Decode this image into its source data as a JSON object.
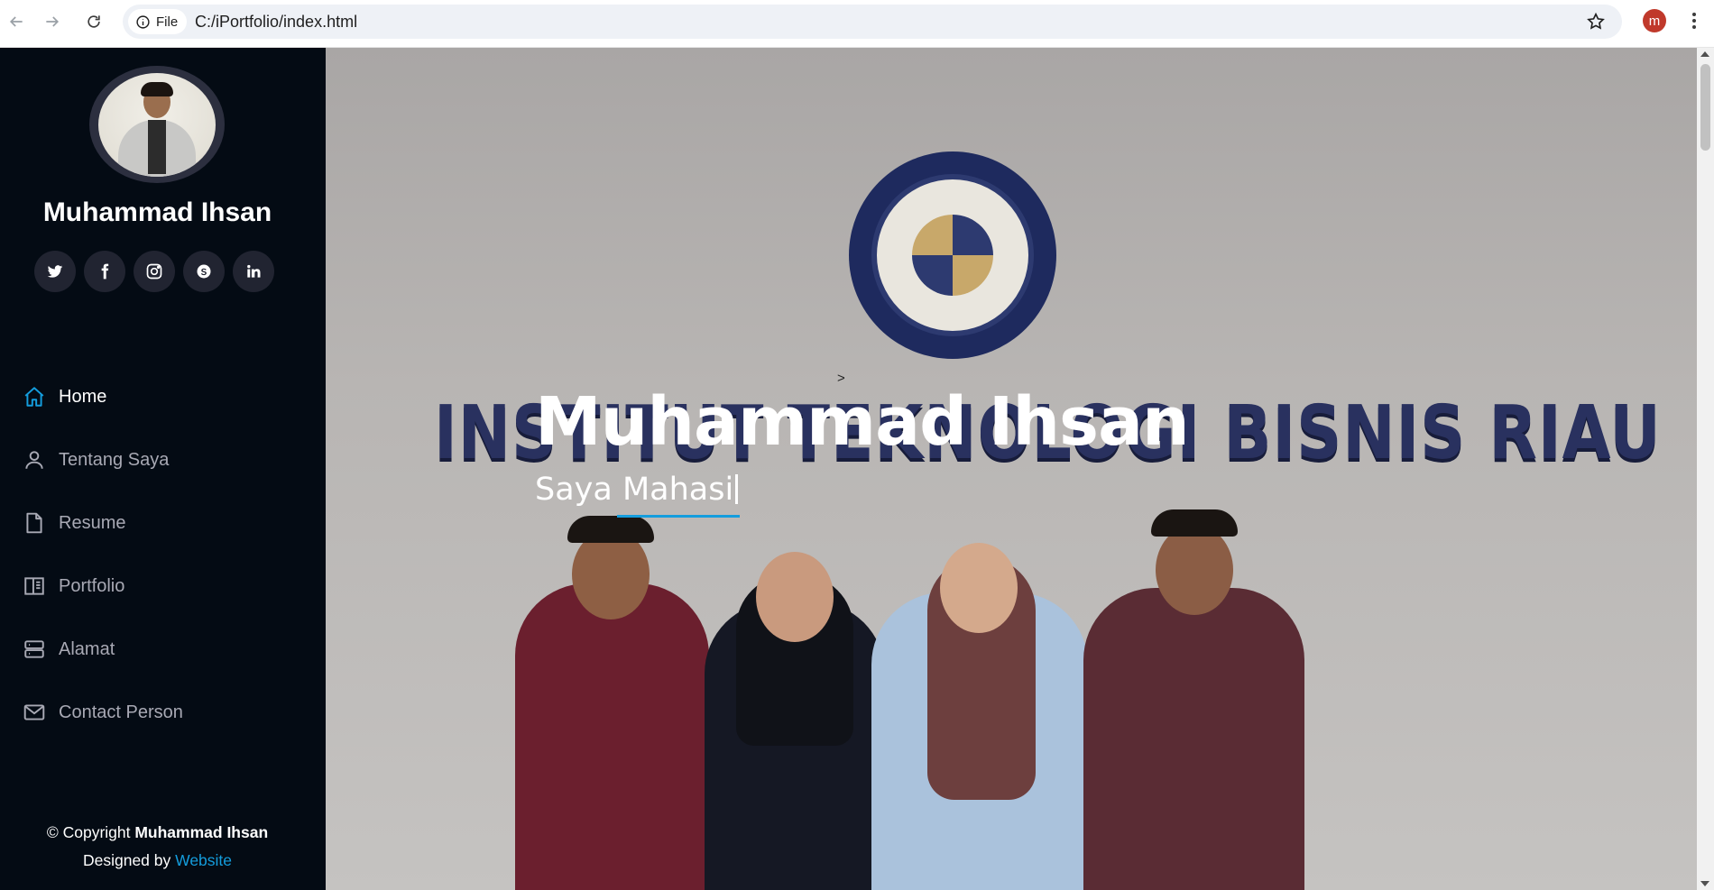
{
  "browser": {
    "site_chip_label": "File",
    "url": "C:/iPortfolio/index.html",
    "profile_initial": "m"
  },
  "sidebar": {
    "name": "Muhammad Ihsan",
    "socials": [
      "twitter-icon",
      "facebook-icon",
      "instagram-icon",
      "skype-icon",
      "linkedin-icon"
    ],
    "menu": [
      {
        "label": "Home",
        "icon": "home-icon",
        "active": true
      },
      {
        "label": "Tentang Saya",
        "icon": "person-icon",
        "active": false
      },
      {
        "label": "Resume",
        "icon": "file-icon",
        "active": false
      },
      {
        "label": "Portfolio",
        "icon": "book-icon",
        "active": false
      },
      {
        "label": "Alamat",
        "icon": "server-icon",
        "active": false
      },
      {
        "label": "Contact Person",
        "icon": "envelope-icon",
        "active": false
      }
    ],
    "footer": {
      "copyright_prefix": "© Copyright ",
      "copyright_name": "Muhammad Ihsan",
      "designed_prefix": "Designed by ",
      "designed_link": "Website"
    }
  },
  "hero": {
    "stray_text": ">",
    "title": "Muhammad Ihsan",
    "typed_text": "Saya Mahasi",
    "backdrop_sign": "INSTITUT TEKNOLOGI BISNIS RIAU"
  },
  "colors": {
    "sidebar_bg": "#040b14",
    "accent": "#149ddd",
    "social_bg": "#212431"
  }
}
